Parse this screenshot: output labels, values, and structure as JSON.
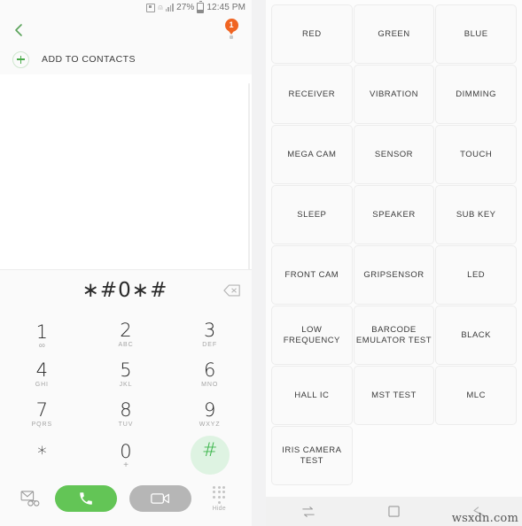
{
  "status_bar": {
    "alarm_icon": "alarm-icon",
    "wifi_icon": "wifi-icon",
    "signal_icon": "signal-bars-icon",
    "battery_percent": "27%",
    "battery_icon": "battery-icon",
    "time": "12:45 PM"
  },
  "dialer": {
    "back_icon": "back-chevron-icon",
    "badge_count": "1",
    "add_to_contacts_label": "ADD TO CONTACTS",
    "add_icon": "plus-circle-icon",
    "number_value": "∗#0∗#",
    "backspace_icon": "backspace-icon",
    "keys": [
      {
        "digit": "1",
        "sub": "∞",
        "sub_kind": "symbol",
        "active": false
      },
      {
        "digit": "2",
        "sub": "ABC",
        "sub_kind": "text",
        "active": false
      },
      {
        "digit": "3",
        "sub": "DEF",
        "sub_kind": "text",
        "active": false
      },
      {
        "digit": "4",
        "sub": "GHI",
        "sub_kind": "text",
        "active": false
      },
      {
        "digit": "5",
        "sub": "JKL",
        "sub_kind": "text",
        "active": false
      },
      {
        "digit": "6",
        "sub": "MNO",
        "sub_kind": "text",
        "active": false
      },
      {
        "digit": "7",
        "sub": "PQRS",
        "sub_kind": "text",
        "active": false
      },
      {
        "digit": "8",
        "sub": "TUV",
        "sub_kind": "text",
        "active": false
      },
      {
        "digit": "9",
        "sub": "WXYZ",
        "sub_kind": "text",
        "active": false
      },
      {
        "digit": "∗",
        "sub": "",
        "sub_kind": "text",
        "active": false
      },
      {
        "digit": "0",
        "sub": "+",
        "sub_kind": "symbol",
        "active": false
      },
      {
        "digit": "#",
        "sub": "",
        "sub_kind": "text",
        "active": true
      }
    ],
    "voicemail_icon": "voicemail-icon",
    "call_icon": "phone-call-icon",
    "video_call_icon": "video-call-icon",
    "hide_icon": "keypad-dots-icon",
    "hide_label": "Hide"
  },
  "service_mode": {
    "tests": [
      "RED",
      "GREEN",
      "BLUE",
      "RECEIVER",
      "VIBRATION",
      "DIMMING",
      "MEGA CAM",
      "SENSOR",
      "TOUCH",
      "SLEEP",
      "SPEAKER",
      "SUB KEY",
      "FRONT CAM",
      "GRIPSENSOR",
      "LED",
      "LOW FREQUENCY",
      "BARCODE EMULATOR TEST",
      "BLACK",
      "HALL IC",
      "MST TEST",
      "MLC",
      "IRIS CAMERA TEST"
    ]
  },
  "nav_bar": {
    "recents_icon": "recents-icon",
    "home_icon": "home-square-icon",
    "back_icon": "back-arrow-icon"
  },
  "watermark": "wsxdn.com",
  "colors": {
    "accent_green": "#63c556",
    "badge_orange": "#f06422",
    "key_active_bg": "#def3e2",
    "video_gray": "#b6b6b6"
  }
}
